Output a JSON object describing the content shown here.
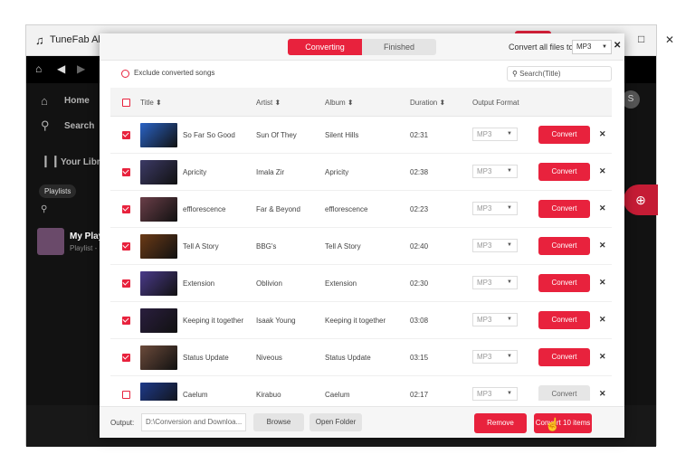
{
  "background_app": {
    "title": "TuneFab All-",
    "sidebar": {
      "home": "Home",
      "search": "Search",
      "library": "Your Libra",
      "playlists_pill": "Playlists",
      "playlist_title": "My Play",
      "playlist_sub": "Playlist -"
    },
    "avatar_letter": "S"
  },
  "dialog": {
    "tabs": [
      {
        "label": "Converting",
        "active": true
      },
      {
        "label": "Finished",
        "active": false
      }
    ],
    "convert_all_label": "Convert all files to:",
    "convert_all_format": "MP3",
    "exclude_label": "Exclude converted songs",
    "search_placeholder": "Search(Title)",
    "columns": {
      "title": "Title ⬍",
      "artist": "Artist ⬍",
      "album": "Album ⬍",
      "duration": "Duration ⬍",
      "output_format": "Output Format"
    },
    "rows": [
      {
        "title": "So Far So Good",
        "artist": "Sun Of They",
        "album": "Silent Hills",
        "duration": "02:31",
        "format": "MP3",
        "checked": true,
        "convert_label": "Convert",
        "convert_enabled": true,
        "thumb": "#2a63c6"
      },
      {
        "title": "Apricity",
        "artist": "Imala Zir",
        "album": "Apricity",
        "duration": "02:38",
        "format": "MP3",
        "checked": true,
        "convert_label": "Convert",
        "convert_enabled": true,
        "thumb": "#3c3a66"
      },
      {
        "title": "efflorescence",
        "artist": "Far & Beyond",
        "album": "efflorescence",
        "duration": "02:23",
        "format": "MP3",
        "checked": true,
        "convert_label": "Convert",
        "convert_enabled": true,
        "thumb": "#6a3e48"
      },
      {
        "title": "Tell A Story",
        "artist": "BBG's",
        "album": "Tell A Story",
        "duration": "02:40",
        "format": "MP3",
        "checked": true,
        "convert_label": "Convert",
        "convert_enabled": true,
        "thumb": "#6b3a16"
      },
      {
        "title": "Extension",
        "artist": "Oblivion",
        "album": "Extension",
        "duration": "02:30",
        "format": "MP3",
        "checked": true,
        "convert_label": "Convert",
        "convert_enabled": true,
        "thumb": "#4a3a8a"
      },
      {
        "title": "Keeping it together",
        "artist": "Isaak Young",
        "album": "Keeping it together",
        "duration": "03:08",
        "format": "MP3",
        "checked": true,
        "convert_label": "Convert",
        "convert_enabled": true,
        "thumb": "#2a1e3e"
      },
      {
        "title": "Status Update",
        "artist": "Niveous",
        "album": "Status Update",
        "duration": "03:15",
        "format": "MP3",
        "checked": true,
        "convert_label": "Convert",
        "convert_enabled": true,
        "thumb": "#6b4a3a"
      },
      {
        "title": "Caelum",
        "artist": "Kirabuo",
        "album": "Caelum",
        "duration": "02:17",
        "format": "MP3",
        "checked": false,
        "convert_label": "Convert",
        "convert_enabled": false,
        "thumb": "#1e3a8a"
      }
    ],
    "footer": {
      "output_label": "Output:",
      "output_path": "D:\\Conversion and Downloa...",
      "browse": "Browse",
      "open_folder": "Open Folder",
      "remove": "Remove",
      "convert_items": "Convert 10 items"
    }
  },
  "colors": {
    "accent": "#e8223d"
  }
}
